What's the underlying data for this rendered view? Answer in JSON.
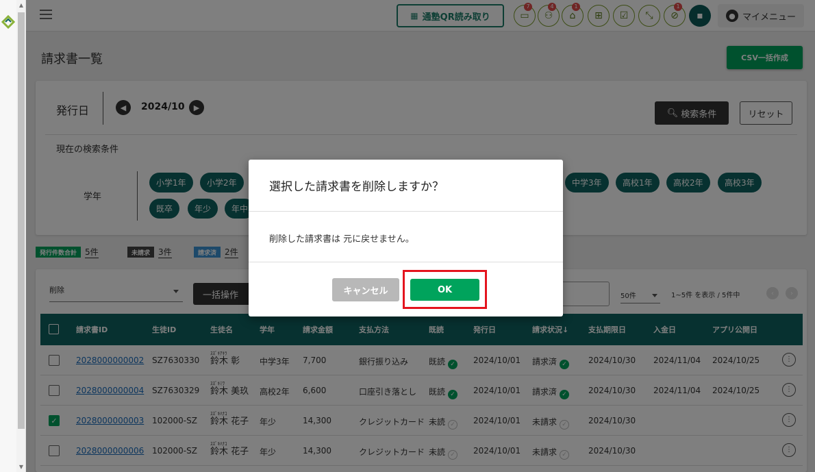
{
  "header": {
    "qr_button": "通塾QR読み取り",
    "icons": [
      {
        "name": "message-icon",
        "badge": "7"
      },
      {
        "name": "users-icon",
        "badge": "4"
      },
      {
        "name": "bank-icon",
        "badge": "1"
      },
      {
        "name": "gift-icon",
        "badge": ""
      },
      {
        "name": "checklist-icon",
        "badge": ""
      },
      {
        "name": "compress-icon",
        "badge": ""
      },
      {
        "name": "no-tracking-icon",
        "badge": "1"
      }
    ],
    "my_menu": "マイメニュー"
  },
  "page": {
    "title": "請求書一覧",
    "csv_button": "CSV一括作成"
  },
  "filter": {
    "date_label": "発行日",
    "date_value": "2024/10",
    "search_button": "検索条件",
    "reset_button": "リセット",
    "current_conditions": "現在の検索条件",
    "grade_label": "学年",
    "chips": [
      "小学1年",
      "小学2年",
      "中学3年",
      "高校1年",
      "高校2年",
      "高校3年",
      "既卒",
      "年少",
      "年中"
    ]
  },
  "counts": {
    "total_label": "発行件数合計",
    "total_value": "5件",
    "unbilled_label": "未請求",
    "unbilled_value": "3件",
    "billed_label": "請求済",
    "billed_value": "2件"
  },
  "toolbar": {
    "select_value": "削除",
    "bulk_button": "一括操作",
    "per_page": "50件",
    "range_text": "1~5件 を表示 / 5件中"
  },
  "table": {
    "headers": [
      "請求書ID",
      "生徒ID",
      "生徒名",
      "学年",
      "請求金額",
      "支払方法",
      "既読",
      "発行日",
      "請求状況↓",
      "支払期限日",
      "入金日",
      "アプリ公開日"
    ],
    "rows": [
      {
        "id": "2028000000002",
        "student_id": "SZ7630330",
        "kana": "ｽｽﾞｷｱｷﾗ",
        "name": "鈴木 彰",
        "grade": "中学3年",
        "amount": "7,700",
        "method": "銀行振り込み",
        "read": "既読",
        "issued": "2024/10/01",
        "status": "請求済",
        "due": "2024/10/30",
        "paid": "2024/11/04",
        "app": "2024/10/25"
      },
      {
        "id": "2028000000004",
        "student_id": "SZ7630329",
        "kana": "ｽｽﾞｷﾐﾜ",
        "name": "鈴木 美玖",
        "grade": "高校2年",
        "amount": "6,600",
        "method": "口座引き落とし",
        "read": "既読",
        "issued": "2024/10/01",
        "status": "請求済",
        "due": "2024/10/30",
        "paid": "2024/11/04",
        "app": "2024/10/25"
      },
      {
        "id": "2028000000003",
        "student_id": "102000-SZ",
        "kana": "ｽｽﾞｷﾊﾅｺ",
        "name": "鈴木 花子",
        "grade": "年少",
        "amount": "14,300",
        "method": "クレジットカード",
        "read": "未読",
        "issued": "2024/10/01",
        "status": "未請求",
        "due": "2024/10/30",
        "paid": "",
        "app": ""
      },
      {
        "id": "2028000000006",
        "student_id": "102000-SZ",
        "kana": "ｽｽﾞｷﾊﾅｺ",
        "name": "鈴木 花子",
        "grade": "年少",
        "amount": "14,300",
        "method": "クレジットカード",
        "read": "未読",
        "issued": "2024/10/01",
        "status": "未請求",
        "due": "2024/10/30",
        "paid": "",
        "app": ""
      }
    ]
  },
  "modal": {
    "title": "選択した請求書を削除しますか？",
    "body": "削除した請求書は 元に戻せません。",
    "cancel": "キャンセル",
    "ok": "OK"
  },
  "colors": {
    "primary": "#0f6360",
    "accent": "#00a35c",
    "highlight": "#e4141e"
  }
}
